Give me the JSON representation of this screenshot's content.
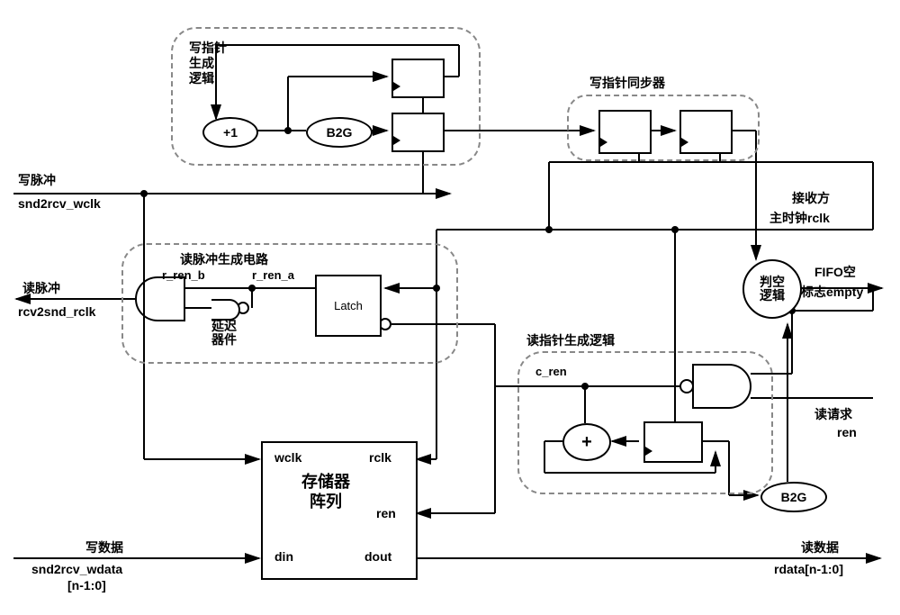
{
  "title_blocks": {
    "write_ptr_gen": "写指针\n生成\n逻辑",
    "write_ptr_sync": "写指针同步器",
    "read_pulse_gen": "读脉冲生成电路",
    "read_ptr_gen": "读指针生成逻辑",
    "empty_logic": "判空\n逻辑"
  },
  "labels": {
    "write_pulse_cn": "写脉冲",
    "write_pulse_en": "snd2rcv_wclk",
    "read_pulse_cn": "读脉冲",
    "read_pulse_en": "rcv2snd_rclk",
    "write_data_cn": "写数据",
    "write_data_en1": "snd2rcv_wdata",
    "write_data_en2": "[n-1:0]",
    "rcv_clk_cn": "接收方",
    "rcv_clk_en": "主时钟rclk",
    "fifo_empty_cn": "FIFO空",
    "fifo_empty_en": "标志empty",
    "read_req_cn": "读请求",
    "read_req_en": "ren",
    "read_data_cn": "读数据",
    "read_data_en": "rdata[n-1:0]",
    "r_ren_b": "r_ren_b",
    "r_ren_a": "r_ren_a",
    "delay_cn": "延迟\n器件",
    "c_ren": "c_ren",
    "latch": "Latch",
    "plus1": "+1",
    "plus": "+",
    "b2g": "B2G",
    "mem_header": "存储器\n阵列",
    "wclk": "wclk",
    "rclk": "rclk",
    "ren": "ren",
    "din": "din",
    "dout": "dout"
  }
}
